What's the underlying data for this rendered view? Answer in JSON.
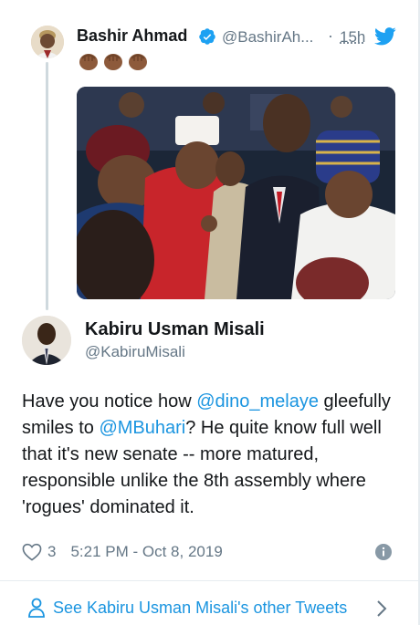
{
  "parent_tweet": {
    "author_name": "Bashir Ahmad",
    "author_handle": "@BashirAh...",
    "separator": "·",
    "time": "15h",
    "emoji": [
      "clap-dark",
      "clap-dark",
      "clap-dark"
    ]
  },
  "main_tweet": {
    "author_name": "Kabiru Usman Misali",
    "author_handle": "@KabiruMisali",
    "text_parts": {
      "p1": "Have you notice how ",
      "m1": "@dino_melaye",
      "p2": " gleefully smiles to ",
      "m2": "@MBuhari",
      "p3": "? He quite know full well that it's new senate -- more matured, responsible unlike the 8th assembly where 'rogues' dominated it."
    },
    "like_count": "3",
    "timestamp": "5:21 PM - Oct 8, 2019"
  },
  "footer": {
    "see_more_label": "See Kabiru Usman Misali's other Tweets"
  },
  "colors": {
    "accent": "#1b95e0",
    "text": "#14171a",
    "muted": "#657786",
    "border": "#e6ecf0"
  },
  "icons": [
    "verified-icon",
    "twitter-bird-icon",
    "heart-icon",
    "info-icon",
    "person-icon",
    "chevron-right-icon"
  ]
}
